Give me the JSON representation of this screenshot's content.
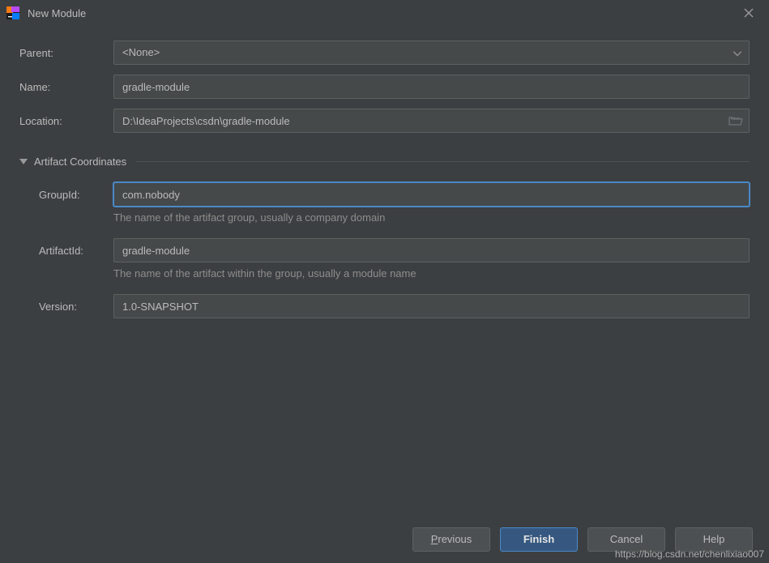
{
  "titlebar": {
    "title": "New Module"
  },
  "form": {
    "parent_label": "Parent:",
    "parent_value": "<None>",
    "name_label": "Name:",
    "name_value": "gradle-module",
    "location_label": "Location:",
    "location_value": "D:\\IdeaProjects\\csdn\\gradle-module",
    "section_label": "Artifact Coordinates",
    "groupid_label": "GroupId:",
    "groupid_value": "com.nobody",
    "groupid_hint": "The name of the artifact group, usually a company domain",
    "artifactid_label": "ArtifactId:",
    "artifactid_value": "gradle-module",
    "artifactid_hint": "The name of the artifact within the group, usually a module name",
    "version_label": "Version:",
    "version_value": "1.0-SNAPSHOT"
  },
  "buttons": {
    "previous": "revious",
    "previous_mnemonic": "P",
    "finish": "Finish",
    "cancel": "Cancel",
    "help": "Help"
  },
  "watermark": "https://blog.csdn.net/chenlixiao007"
}
